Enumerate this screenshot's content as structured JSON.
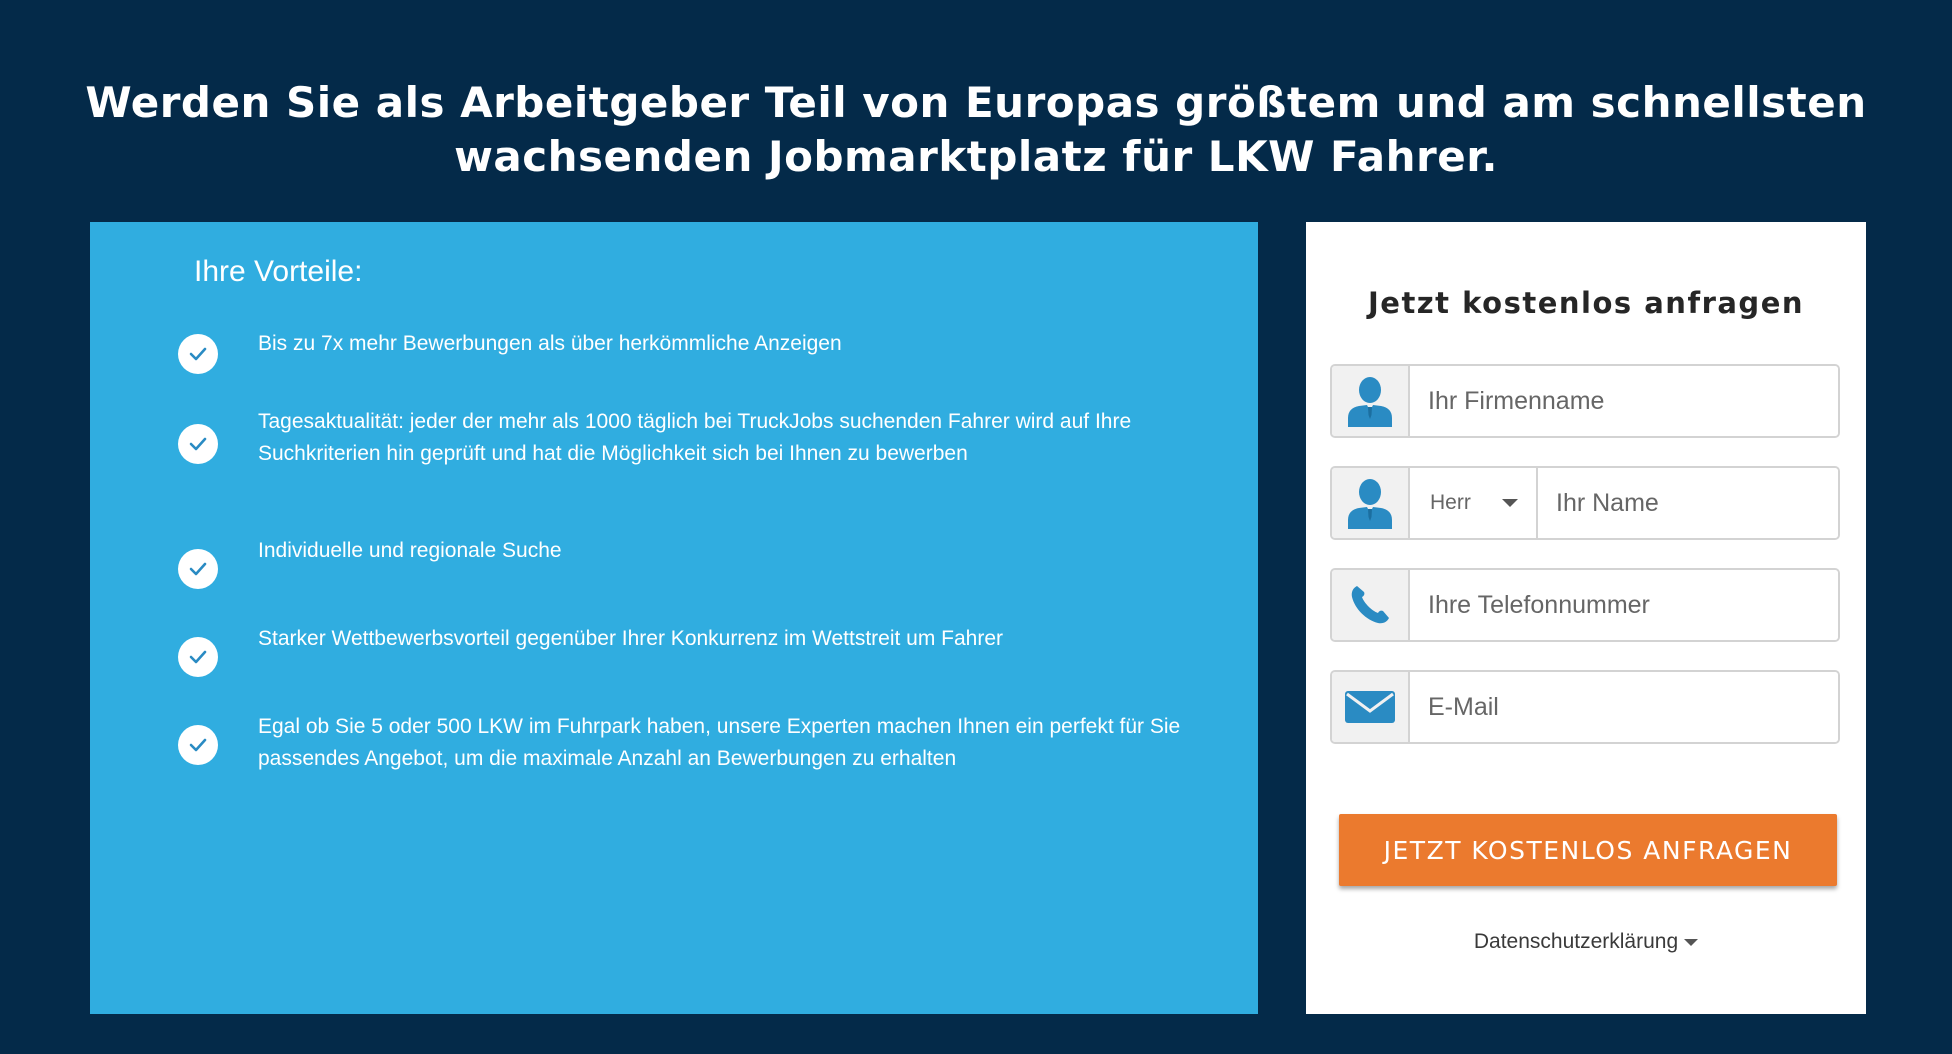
{
  "headline": {
    "line1": "Werden Sie als Arbeitgeber Teil von Europas größtem und am schnellsten",
    "line2": "wachsenden Jobmarktplatz für LKW Fahrer."
  },
  "benefits": {
    "title": "Ihre Vorteile:",
    "items": [
      {
        "text": "Bis zu 7x mehr Bewerbungen als über herkömmliche Anzeigen"
      },
      {
        "text": "Tagesaktualität: jeder der mehr als 1000 täglich bei TruckJobs suchenden Fahrer wird auf Ihre Suchkriterien hin geprüft und hat die Möglichkeit sich bei Ihnen zu bewerben"
      },
      {
        "text": "Individuelle und regionale Suche"
      },
      {
        "text": "Starker Wettbewerbsvorteil gegenüber Ihrer Konkurrenz im Wettstreit um Fahrer"
      },
      {
        "text": "Egal ob Sie 5 oder 500 LKW im Fuhrpark haben, unsere Experten machen Ihnen ein perfekt für Sie passendes Angebot, um die maximale Anzahl an Bewerbungen zu erhalten"
      }
    ]
  },
  "form": {
    "title": "Jetzt kostenlos anfragen",
    "company": {
      "placeholder": "Ihr Firmenname",
      "value": "",
      "icon": "person-icon"
    },
    "name": {
      "placeholder": "Ihr Name",
      "value": "",
      "salutation": "Herr",
      "icon": "person-icon"
    },
    "phone": {
      "placeholder": "Ihre Telefonnummer",
      "value": "",
      "icon": "phone-icon"
    },
    "email": {
      "placeholder": "E-Mail",
      "value": "",
      "icon": "envelope-icon"
    },
    "submit_label": "JETZT KOSTENLOS ANFRAGEN",
    "privacy_label": "Datenschutzerklärung"
  },
  "colors": {
    "page_background": "#042a49",
    "benefits_background": "#30ade0",
    "icon_blue": "#2a8bc3",
    "button_orange": "#eb7a2e"
  }
}
